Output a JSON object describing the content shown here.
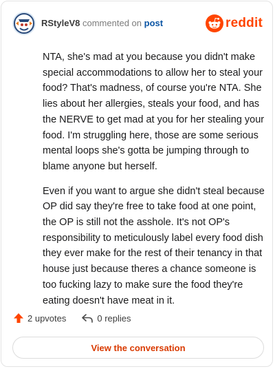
{
  "header": {
    "username": "RStyleV8",
    "action": "commented on",
    "post_link": "post",
    "brand": "reddit"
  },
  "comment": {
    "paragraphs": [
      "NTA, she's mad at you because you didn't make special accommodations to allow her to steal your food? That's madness, of course you're NTA. She lies about her allergies, steals your food, and has the NERVE to get mad at you for her stealing your food. I'm struggling here, those are some serious mental loops she's gotta be jumping through to blame anyone but herself.",
      "Even if you want to argue she didn't steal because OP did say they're free to take food at one point, the OP is still not the asshole. It's not OP's responsibility to meticulously label every food dish they ever make for the rest of their tenancy in that house just because theres a chance someone is too fucking lazy to make sure the food they're eating doesn't have meat in it."
    ]
  },
  "footer": {
    "upvotes": "2 upvotes",
    "replies": "0 replies",
    "upvote_icon": "upvote-arrow-icon",
    "reply_icon": "reply-arrow-icon"
  },
  "view_button": "View the conversation",
  "colors": {
    "brand": "#ff4500",
    "link": "#0b55a4",
    "button_text": "#d93a00"
  }
}
